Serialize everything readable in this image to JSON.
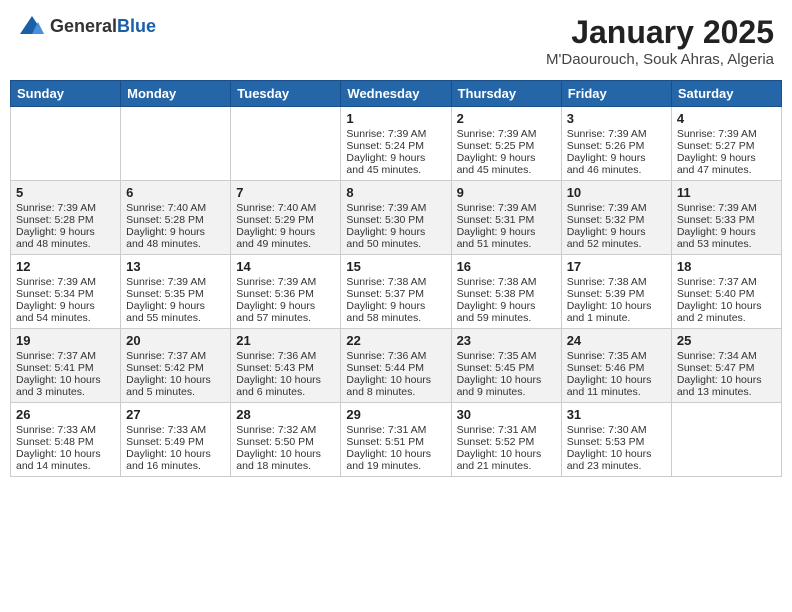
{
  "header": {
    "logo_general": "General",
    "logo_blue": "Blue",
    "month": "January 2025",
    "location": "M'Daourouch, Souk Ahras, Algeria"
  },
  "weekdays": [
    "Sunday",
    "Monday",
    "Tuesday",
    "Wednesday",
    "Thursday",
    "Friday",
    "Saturday"
  ],
  "weeks": [
    [
      {
        "day": "",
        "lines": []
      },
      {
        "day": "",
        "lines": []
      },
      {
        "day": "",
        "lines": []
      },
      {
        "day": "1",
        "lines": [
          "Sunrise: 7:39 AM",
          "Sunset: 5:24 PM",
          "Daylight: 9 hours",
          "and 45 minutes."
        ]
      },
      {
        "day": "2",
        "lines": [
          "Sunrise: 7:39 AM",
          "Sunset: 5:25 PM",
          "Daylight: 9 hours",
          "and 45 minutes."
        ]
      },
      {
        "day": "3",
        "lines": [
          "Sunrise: 7:39 AM",
          "Sunset: 5:26 PM",
          "Daylight: 9 hours",
          "and 46 minutes."
        ]
      },
      {
        "day": "4",
        "lines": [
          "Sunrise: 7:39 AM",
          "Sunset: 5:27 PM",
          "Daylight: 9 hours",
          "and 47 minutes."
        ]
      }
    ],
    [
      {
        "day": "5",
        "lines": [
          "Sunrise: 7:39 AM",
          "Sunset: 5:28 PM",
          "Daylight: 9 hours",
          "and 48 minutes."
        ]
      },
      {
        "day": "6",
        "lines": [
          "Sunrise: 7:40 AM",
          "Sunset: 5:28 PM",
          "Daylight: 9 hours",
          "and 48 minutes."
        ]
      },
      {
        "day": "7",
        "lines": [
          "Sunrise: 7:40 AM",
          "Sunset: 5:29 PM",
          "Daylight: 9 hours",
          "and 49 minutes."
        ]
      },
      {
        "day": "8",
        "lines": [
          "Sunrise: 7:39 AM",
          "Sunset: 5:30 PM",
          "Daylight: 9 hours",
          "and 50 minutes."
        ]
      },
      {
        "day": "9",
        "lines": [
          "Sunrise: 7:39 AM",
          "Sunset: 5:31 PM",
          "Daylight: 9 hours",
          "and 51 minutes."
        ]
      },
      {
        "day": "10",
        "lines": [
          "Sunrise: 7:39 AM",
          "Sunset: 5:32 PM",
          "Daylight: 9 hours",
          "and 52 minutes."
        ]
      },
      {
        "day": "11",
        "lines": [
          "Sunrise: 7:39 AM",
          "Sunset: 5:33 PM",
          "Daylight: 9 hours",
          "and 53 minutes."
        ]
      }
    ],
    [
      {
        "day": "12",
        "lines": [
          "Sunrise: 7:39 AM",
          "Sunset: 5:34 PM",
          "Daylight: 9 hours",
          "and 54 minutes."
        ]
      },
      {
        "day": "13",
        "lines": [
          "Sunrise: 7:39 AM",
          "Sunset: 5:35 PM",
          "Daylight: 9 hours",
          "and 55 minutes."
        ]
      },
      {
        "day": "14",
        "lines": [
          "Sunrise: 7:39 AM",
          "Sunset: 5:36 PM",
          "Daylight: 9 hours",
          "and 57 minutes."
        ]
      },
      {
        "day": "15",
        "lines": [
          "Sunrise: 7:38 AM",
          "Sunset: 5:37 PM",
          "Daylight: 9 hours",
          "and 58 minutes."
        ]
      },
      {
        "day": "16",
        "lines": [
          "Sunrise: 7:38 AM",
          "Sunset: 5:38 PM",
          "Daylight: 9 hours",
          "and 59 minutes."
        ]
      },
      {
        "day": "17",
        "lines": [
          "Sunrise: 7:38 AM",
          "Sunset: 5:39 PM",
          "Daylight: 10 hours",
          "and 1 minute."
        ]
      },
      {
        "day": "18",
        "lines": [
          "Sunrise: 7:37 AM",
          "Sunset: 5:40 PM",
          "Daylight: 10 hours",
          "and 2 minutes."
        ]
      }
    ],
    [
      {
        "day": "19",
        "lines": [
          "Sunrise: 7:37 AM",
          "Sunset: 5:41 PM",
          "Daylight: 10 hours",
          "and 3 minutes."
        ]
      },
      {
        "day": "20",
        "lines": [
          "Sunrise: 7:37 AM",
          "Sunset: 5:42 PM",
          "Daylight: 10 hours",
          "and 5 minutes."
        ]
      },
      {
        "day": "21",
        "lines": [
          "Sunrise: 7:36 AM",
          "Sunset: 5:43 PM",
          "Daylight: 10 hours",
          "and 6 minutes."
        ]
      },
      {
        "day": "22",
        "lines": [
          "Sunrise: 7:36 AM",
          "Sunset: 5:44 PM",
          "Daylight: 10 hours",
          "and 8 minutes."
        ]
      },
      {
        "day": "23",
        "lines": [
          "Sunrise: 7:35 AM",
          "Sunset: 5:45 PM",
          "Daylight: 10 hours",
          "and 9 minutes."
        ]
      },
      {
        "day": "24",
        "lines": [
          "Sunrise: 7:35 AM",
          "Sunset: 5:46 PM",
          "Daylight: 10 hours",
          "and 11 minutes."
        ]
      },
      {
        "day": "25",
        "lines": [
          "Sunrise: 7:34 AM",
          "Sunset: 5:47 PM",
          "Daylight: 10 hours",
          "and 13 minutes."
        ]
      }
    ],
    [
      {
        "day": "26",
        "lines": [
          "Sunrise: 7:33 AM",
          "Sunset: 5:48 PM",
          "Daylight: 10 hours",
          "and 14 minutes."
        ]
      },
      {
        "day": "27",
        "lines": [
          "Sunrise: 7:33 AM",
          "Sunset: 5:49 PM",
          "Daylight: 10 hours",
          "and 16 minutes."
        ]
      },
      {
        "day": "28",
        "lines": [
          "Sunrise: 7:32 AM",
          "Sunset: 5:50 PM",
          "Daylight: 10 hours",
          "and 18 minutes."
        ]
      },
      {
        "day": "29",
        "lines": [
          "Sunrise: 7:31 AM",
          "Sunset: 5:51 PM",
          "Daylight: 10 hours",
          "and 19 minutes."
        ]
      },
      {
        "day": "30",
        "lines": [
          "Sunrise: 7:31 AM",
          "Sunset: 5:52 PM",
          "Daylight: 10 hours",
          "and 21 minutes."
        ]
      },
      {
        "day": "31",
        "lines": [
          "Sunrise: 7:30 AM",
          "Sunset: 5:53 PM",
          "Daylight: 10 hours",
          "and 23 minutes."
        ]
      },
      {
        "day": "",
        "lines": []
      }
    ]
  ]
}
